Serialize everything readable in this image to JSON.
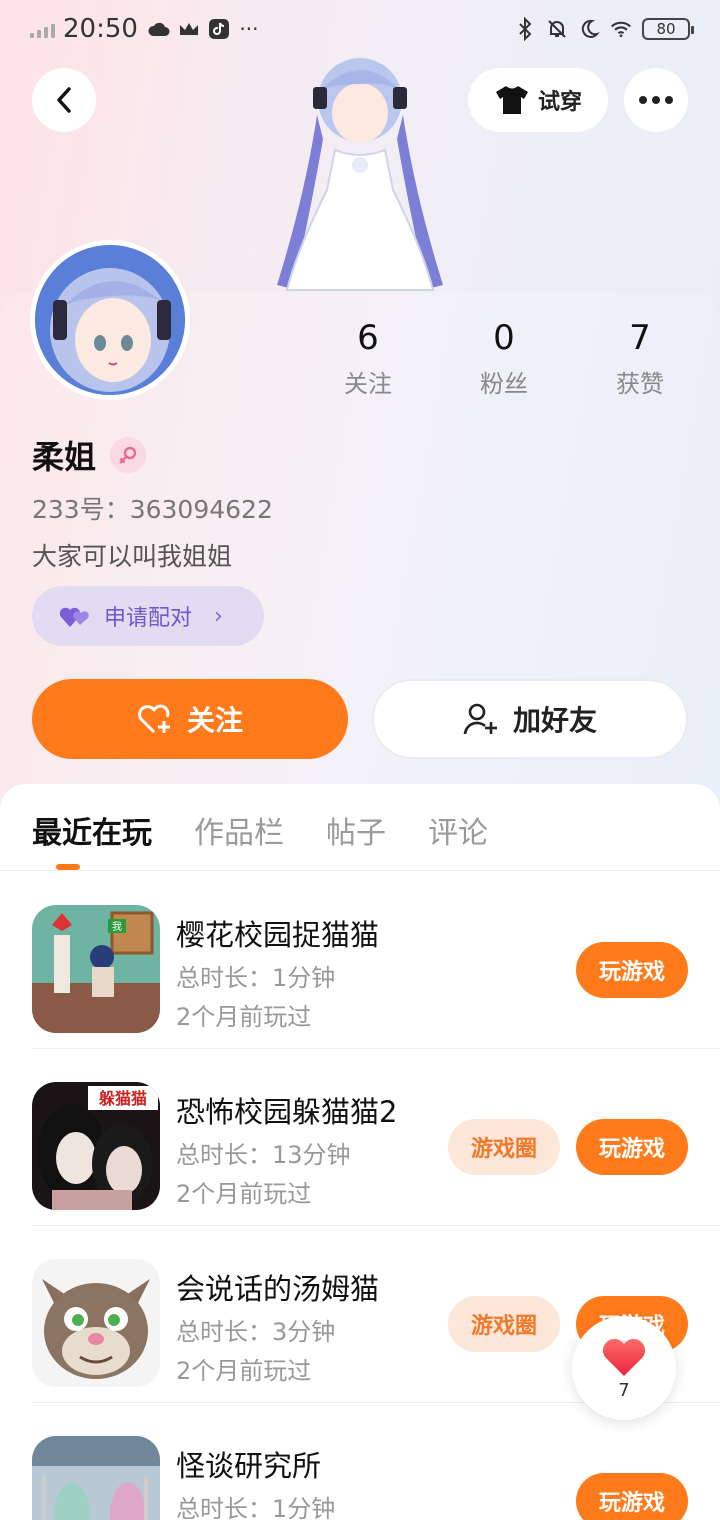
{
  "status_bar": {
    "time": "20:50",
    "battery": "80"
  },
  "header": {
    "tryon_label": "试穿"
  },
  "profile": {
    "stats": [
      {
        "value": "6",
        "label": "关注"
      },
      {
        "value": "0",
        "label": "粉丝"
      },
      {
        "value": "7",
        "label": "获赞"
      }
    ],
    "name": "柔姐",
    "id_line": "233号：363094622",
    "bio": "大家可以叫我姐姐",
    "pair_label": "申请配对",
    "follow_label": "关注",
    "add_friend_label": "加好友"
  },
  "tabs": [
    {
      "label": "最近在玩"
    },
    {
      "label": "作品栏"
    },
    {
      "label": "帖子"
    },
    {
      "label": "评论"
    }
  ],
  "games": [
    {
      "title": "樱花校园捉猫猫",
      "duration": "总时长：1分钟",
      "last_played": "2个月前玩过",
      "play_label": "玩游戏",
      "icon": "sakura-school-icon"
    },
    {
      "title": "恐怖校园躲猫猫2",
      "duration": "总时长：13分钟",
      "last_played": "2个月前玩过",
      "play_label": "玩游戏",
      "circle_label": "游戏圈",
      "icon": "horror-school-icon",
      "icon_text": "躲猫猫"
    },
    {
      "title": "会说话的汤姆猫",
      "duration": "总时长：3分钟",
      "last_played": "2个月前玩过",
      "play_label": "玩游戏",
      "circle_label": "游戏圈",
      "icon": "talking-tom-icon"
    },
    {
      "title": "怪谈研究所",
      "duration": "总时长：1分钟",
      "play_label": "玩游戏",
      "icon": "ghost-lab-icon"
    }
  ],
  "like_float": {
    "count": "7"
  },
  "colors": {
    "accent": "#ff7a1a",
    "pair": "#6f58c9"
  }
}
